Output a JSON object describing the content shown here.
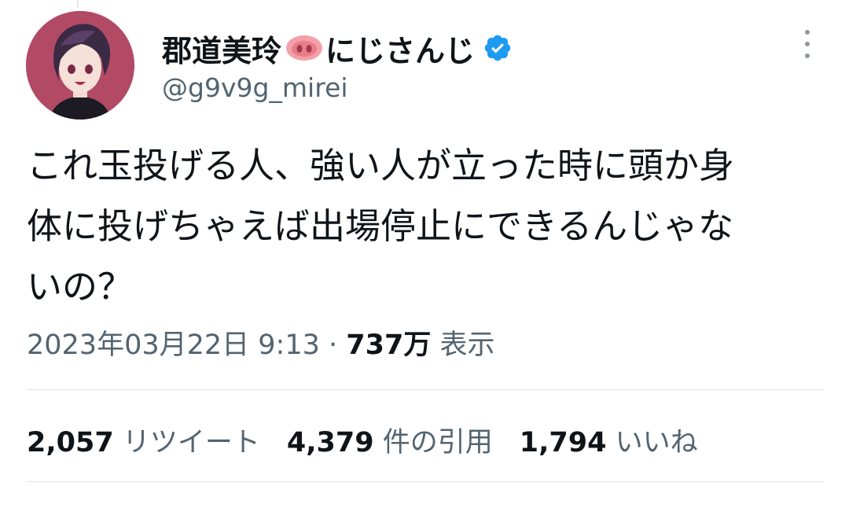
{
  "user": {
    "display_name_prefix": "郡道美玲",
    "display_name_suffix": "にじさんじ",
    "emoji_icon": "pig-nose-icon",
    "verified_icon": "verified-badge-icon",
    "handle": "@g9v9g_mirei"
  },
  "tweet": {
    "text": "これ玉投げる人、強い人が立った時に頭か身\n体に投げちゃえば出場停止にできるんじゃな\nいの？",
    "timestamp": "2023年03月22日 9:13",
    "separator": " · ",
    "views_count": "737万",
    "views_label": "表示"
  },
  "stats": {
    "retweets_count": "2,057",
    "retweets_label": "リツイート",
    "quotes_count": "4,379",
    "quotes_label": "件の引用",
    "likes_count": "1,794",
    "likes_label": "いいね"
  },
  "colors": {
    "text_primary": "#0f1419",
    "text_secondary": "#536471",
    "verified": "#1d9bf0",
    "divider": "#dfe3e7"
  }
}
